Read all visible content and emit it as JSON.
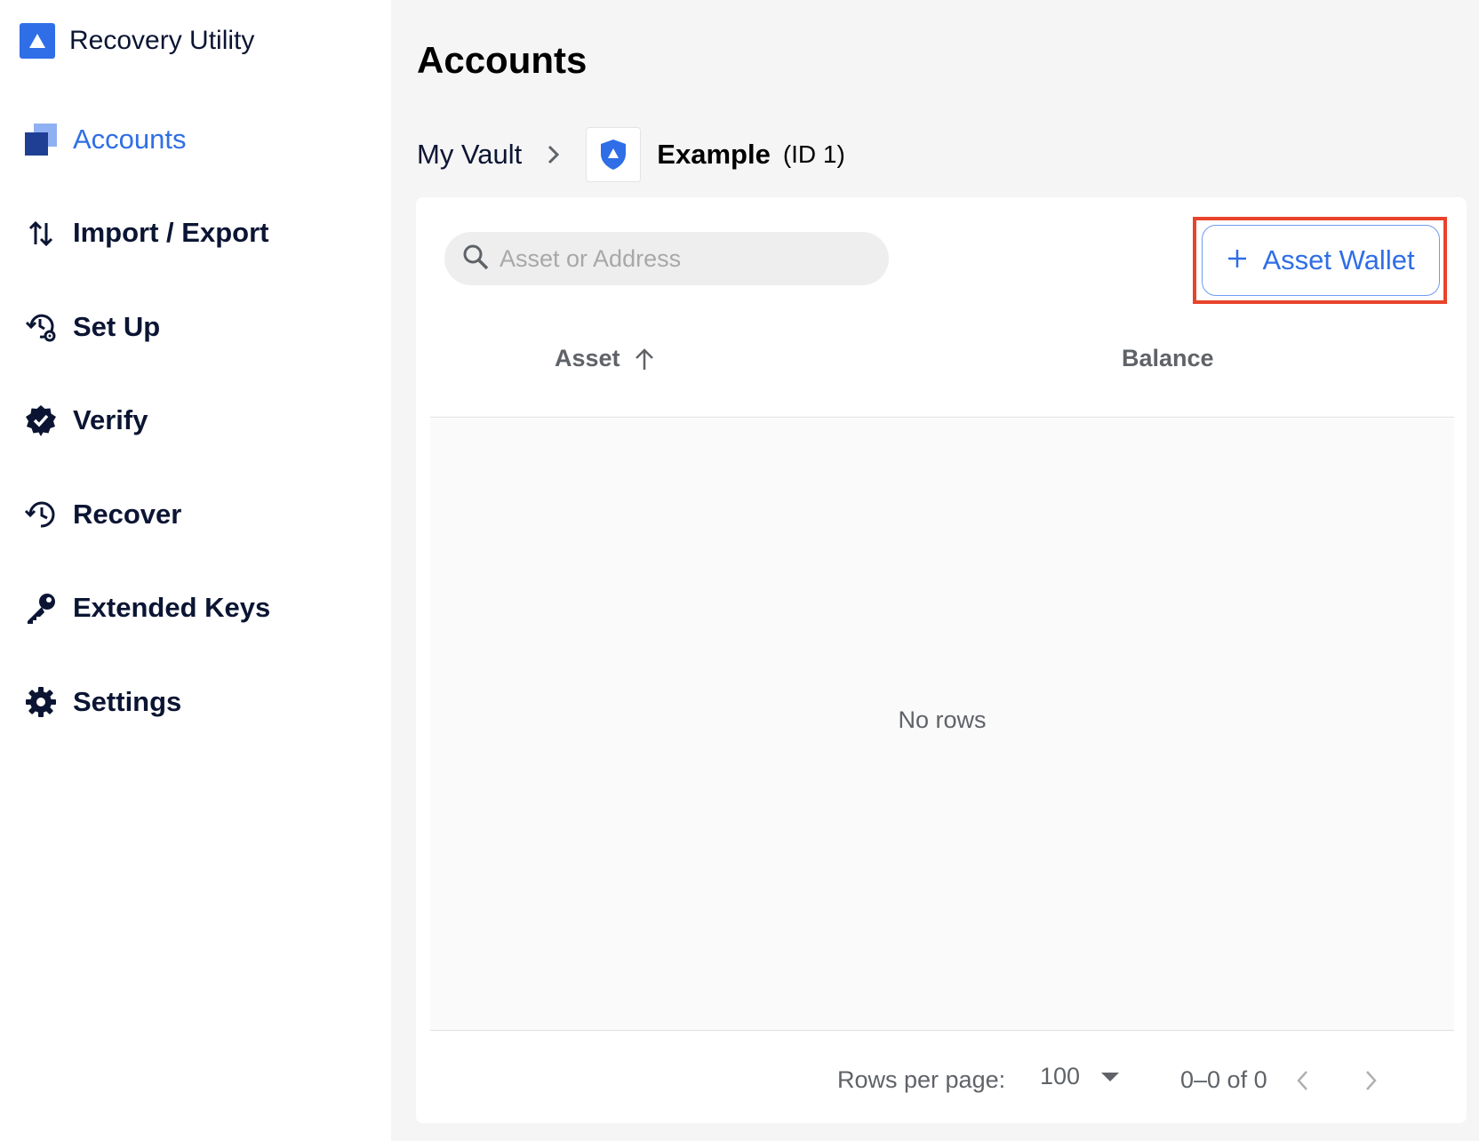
{
  "app": {
    "title": "Recovery Utility",
    "brand_color": "#2f6ee6"
  },
  "sidebar": {
    "items": [
      {
        "label": "Accounts",
        "icon": "accounts-icon",
        "active": true
      },
      {
        "label": "Import / Export",
        "icon": "import-export-icon",
        "active": false
      },
      {
        "label": "Set Up",
        "icon": "setup-icon",
        "active": false
      },
      {
        "label": "Verify",
        "icon": "verify-icon",
        "active": false
      },
      {
        "label": "Recover",
        "icon": "recover-icon",
        "active": false
      },
      {
        "label": "Extended Keys",
        "icon": "key-icon",
        "active": false
      },
      {
        "label": "Settings",
        "icon": "gear-icon",
        "active": false
      }
    ]
  },
  "main": {
    "page_title": "Accounts",
    "breadcrumb": {
      "root": "My Vault",
      "vault_name": "Example",
      "vault_id": "(ID 1)"
    },
    "search": {
      "placeholder": "Asset or Address",
      "value": ""
    },
    "add_button_label": "Asset Wallet",
    "table": {
      "columns": [
        "Asset",
        "Balance"
      ],
      "sort_column": "Asset",
      "sort_direction": "ascending",
      "rows": [],
      "empty_text": "No rows"
    },
    "pagination": {
      "rows_per_page_label": "Rows per page:",
      "rows_per_page_value": "100",
      "range_text": "0–0 of 0"
    }
  }
}
